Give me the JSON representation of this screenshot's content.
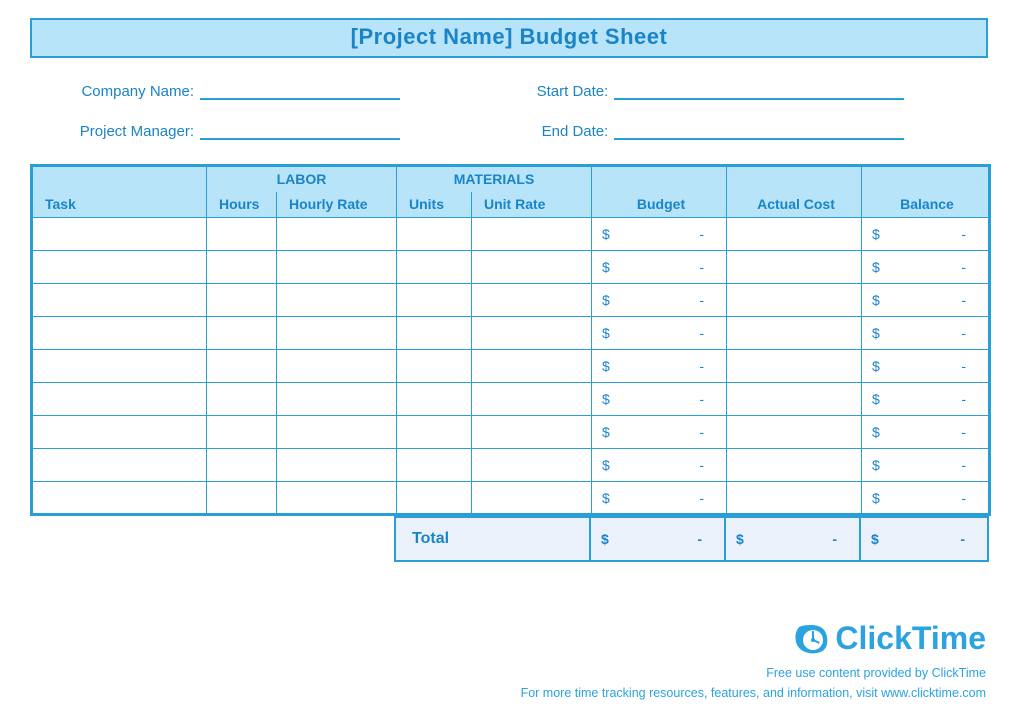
{
  "title": "[Project Name] Budget Sheet",
  "meta": {
    "company_label": "Company Name:",
    "manager_label": "Project Manager:",
    "start_label": "Start Date:",
    "end_label": "End Date:"
  },
  "headers": {
    "labor": "LABOR",
    "materials": "MATERIALS",
    "task": "Task",
    "hours": "Hours",
    "hourly_rate": "Hourly Rate",
    "units": "Units",
    "unit_rate": "Unit Rate",
    "budget": "Budget",
    "actual_cost": "Actual Cost",
    "balance": "Balance"
  },
  "money": {
    "sym": "$",
    "dash": "-"
  },
  "totals": {
    "label": "Total"
  },
  "footer": {
    "brand": "ClickTime",
    "line1": "Free use content provided by ClickTime",
    "line2": "For more time tracking resources, features, and information, visit www.clicktime.com"
  },
  "cols": {
    "task": 175,
    "hours": 70,
    "hourly_rate": 120,
    "units": 75,
    "unit_rate": 120,
    "budget": 135,
    "actual_cost": 135,
    "balance": 128
  }
}
